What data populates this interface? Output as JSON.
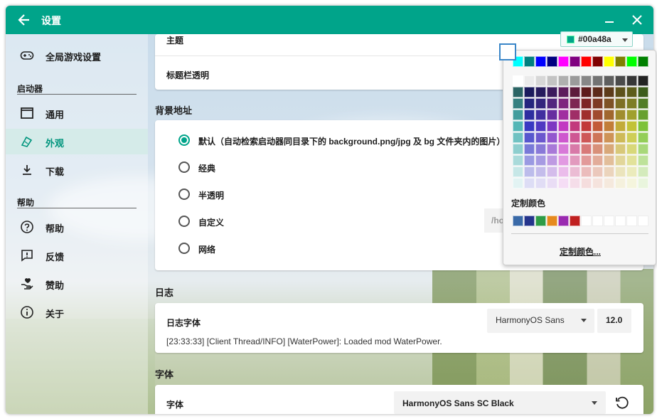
{
  "window": {
    "title": "设置"
  },
  "sidebar": {
    "global": "全局游戏设置",
    "section_launcher": "启动器",
    "items_launcher": [
      "通用",
      "外观",
      "下载"
    ],
    "section_help": "帮助",
    "items_help": [
      "帮助",
      "反馈",
      "赞助",
      "关于"
    ]
  },
  "appearance": {
    "theme_label": "主题",
    "theme_value": "#00a48a",
    "titlebar_label": "标题栏透明",
    "bg_section": "背景地址",
    "bg_options": [
      "默认（自动检索启动器同目录下的 background.png/jpg 及 bg 文件夹内的图片）",
      "经典",
      "半透明",
      "自定义",
      "网络"
    ],
    "bg_custom_placeholder": "/ho"
  },
  "log": {
    "section": "日志",
    "font_label": "日志字体",
    "font_value": "HarmonyOS Sans",
    "font_size": "12.0",
    "sample": "[23:33:33] [Client Thread/INFO] [WaterPower]: Loaded mod WaterPower."
  },
  "font": {
    "section": "字体",
    "label": "字体",
    "value": "HarmonyOS Sans SC Black"
  },
  "picker": {
    "custom_title": "定制颜色",
    "custom_link": "定制颜色...",
    "top_row": [
      "#00ffff",
      "#008080",
      "#0000ff",
      "#000080",
      "#ff00ff",
      "#800080",
      "#ff0000",
      "#800000",
      "#ffff00",
      "#808000",
      "#00ff00",
      "#008000"
    ],
    "custom_colors": [
      "#3a6aa8",
      "#24348c",
      "#2e9c46",
      "#e68a1e",
      "#9a2ab0",
      "#c02020"
    ]
  },
  "colors": {
    "accent": "#00a48a"
  }
}
